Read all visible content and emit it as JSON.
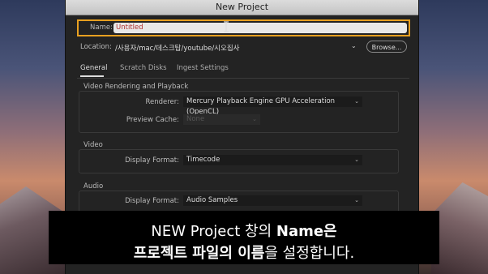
{
  "dialog": {
    "title": "New Project",
    "name_label": "Name:",
    "name_value": "Untitled",
    "location_label": "Location:",
    "location_value": "/사용자/mac/데스크탑/youtube/시오집사",
    "browse_label": "Browse..."
  },
  "tabs": [
    {
      "label": "General",
      "active": true
    },
    {
      "label": "Scratch Disks",
      "active": false
    },
    {
      "label": "Ingest Settings",
      "active": false
    }
  ],
  "video_rendering": {
    "title": "Video Rendering and Playback",
    "renderer_label": "Renderer:",
    "renderer_value": "Mercury Playback Engine GPU Acceleration (OpenCL)",
    "preview_cache_label": "Preview Cache:",
    "preview_cache_value": "None"
  },
  "video": {
    "title": "Video",
    "display_format_label": "Display Format:",
    "display_format_value": "Timecode"
  },
  "audio": {
    "title": "Audio",
    "display_format_label": "Display Format:",
    "display_format_value": "Audio Samples"
  },
  "caption": {
    "line1_a": "NEW Project 창의 ",
    "line1_b": "Name은",
    "line2_a": "프로젝트 파일의 이름",
    "line2_b": "을 설정합니다."
  },
  "colors": {
    "highlight": "#e8a020",
    "dialog_bg": "#232323"
  },
  "icons": {
    "text_cursor": "text-cursor-icon",
    "chevron": "chevron-down-icon"
  }
}
